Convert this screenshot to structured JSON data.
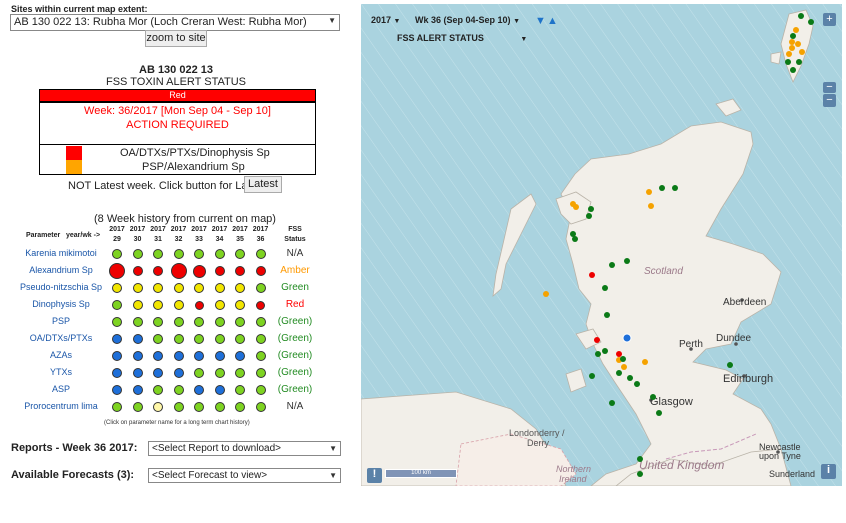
{
  "sites": {
    "label": "Sites within current map extent:",
    "selected": "AB 130 022 13: Rubha Mor (Loch Creran West: Rubha Mor)",
    "zoom_label": "zoom to site"
  },
  "alert": {
    "site_code": "AB 130 022 13",
    "title": "FSS TOXIN ALERT STATUS",
    "status_text": "Red",
    "week_text": "Week: 36/2017 [Mon Sep 04 - Sep 10]",
    "action_text": "ACTION REQUIRED",
    "legend": [
      {
        "color": "#ff0000",
        "text": "OA/DTXs/PTXs/Dinophysis Sp"
      },
      {
        "color": "#ffa500",
        "text": "PSP/Alexandrium Sp"
      }
    ],
    "not_latest_text": "NOT Latest week. Click button for Latest",
    "latest_label": "Latest"
  },
  "history": {
    "title": "(8 Week history from current on map)",
    "param_header": "Parameter",
    "yearwk_header": "year/wk ->",
    "fss_header_1": "FSS",
    "fss_header_2": "Status",
    "years": [
      "2017",
      "2017",
      "2017",
      "2017",
      "2017",
      "2017",
      "2017",
      "2017"
    ],
    "weeks": [
      "29",
      "30",
      "31",
      "32",
      "33",
      "34",
      "35",
      "36"
    ],
    "rows": [
      {
        "name": "Karenia mikimotoi",
        "dots": [
          "green",
          "green",
          "green",
          "green",
          "green",
          "green",
          "green",
          "green"
        ],
        "sizes": [
          1,
          1,
          1,
          1,
          1,
          1,
          1,
          1
        ],
        "status": "N/A",
        "status_color": "#333333"
      },
      {
        "name": "Alexandrium Sp",
        "dots": [
          "red",
          "red",
          "red",
          "red",
          "red",
          "red",
          "red",
          "red"
        ],
        "sizes": [
          1.6,
          1,
          1,
          1.6,
          1.3,
          1,
          1,
          1
        ],
        "status": "Amber",
        "status_color": "#ff9900"
      },
      {
        "name": "Pseudo-nitzschia Sp",
        "dots": [
          "yellow",
          "yellow",
          "yellow",
          "yellow",
          "yellow",
          "yellow",
          "yellow",
          "green"
        ],
        "sizes": [
          1,
          1,
          1,
          1,
          1,
          1,
          1,
          1
        ],
        "status": "Green",
        "status_color": "#228b22"
      },
      {
        "name": "Dinophysis Sp",
        "dots": [
          "green",
          "yellow",
          "yellow",
          "yellow",
          "red",
          "yellow",
          "yellow",
          "red"
        ],
        "sizes": [
          1,
          1,
          1,
          1,
          0.9,
          1,
          1,
          0.9
        ],
        "status": "Red",
        "status_color": "#ff0000"
      },
      {
        "name": "PSP",
        "dots": [
          "green",
          "green",
          "green",
          "green",
          "green",
          "green",
          "green",
          "green"
        ],
        "sizes": [
          1,
          1,
          1,
          1,
          1,
          1,
          1,
          1
        ],
        "status": "(Green)",
        "status_color": "#228b22"
      },
      {
        "name": "OA/DTXs/PTXs",
        "dots": [
          "blue",
          "blue",
          "green",
          "green",
          "green",
          "green",
          "green",
          "green"
        ],
        "sizes": [
          1,
          1,
          1,
          1,
          1,
          1,
          1,
          1
        ],
        "status": "(Green)",
        "status_color": "#228b22"
      },
      {
        "name": "AZAs",
        "dots": [
          "blue",
          "blue",
          "blue",
          "blue",
          "blue",
          "blue",
          "blue",
          "green"
        ],
        "sizes": [
          1,
          1,
          1,
          1,
          1,
          1,
          1,
          1
        ],
        "status": "(Green)",
        "status_color": "#228b22"
      },
      {
        "name": "YTXs",
        "dots": [
          "blue",
          "blue",
          "blue",
          "blue",
          "green",
          "green",
          "green",
          "green"
        ],
        "sizes": [
          1,
          1,
          1,
          1,
          1,
          1,
          1,
          1
        ],
        "status": "(Green)",
        "status_color": "#228b22"
      },
      {
        "name": "ASP",
        "dots": [
          "blue",
          "blue",
          "green",
          "green",
          "blue",
          "blue",
          "green",
          "green"
        ],
        "sizes": [
          1,
          1,
          1,
          1,
          1,
          1,
          1,
          1
        ],
        "status": "(Green)",
        "status_color": "#228b22"
      },
      {
        "name": "Prorocentrum lima",
        "dots": [
          "green",
          "green",
          "lightyellow",
          "green",
          "green",
          "green",
          "green",
          "green"
        ],
        "sizes": [
          1,
          1,
          1,
          1,
          1,
          1,
          1,
          1
        ],
        "status": "N/A",
        "status_color": "#333333"
      }
    ],
    "note": "(Click on parameter name for a long term chart history)"
  },
  "colors": {
    "green": "#7ed321",
    "red": "#ee0000",
    "yellow": "#f2e600",
    "lightyellow": "#fff7a8",
    "blue": "#1e6fd9",
    "orange": "#f5a200",
    "darkgreen": "#0b7a17"
  },
  "reports": {
    "label": "Reports - Week 36 2017:",
    "selected": "<Select Report to download>"
  },
  "forecasts": {
    "label": "Available Forecasts (3):",
    "selected": "<Select Forecast to view>"
  },
  "map": {
    "year": "2017",
    "week": "Wk 36 (Sep 04-Sep 10)",
    "layer": "FSS ALERT STATUS",
    "zoom_in": "+",
    "zoom_out": "−",
    "info": "i",
    "warn": "!",
    "scale_text": "100 km",
    "labels": {
      "scotland": "Scotland",
      "aberdeen": "Aberdeen",
      "dundee": "Dundee",
      "perth": "Perth",
      "edinburgh": "Edinburgh",
      "glasgow": "Glasgow",
      "londonderry": "Londonderry /",
      "derry": "Derry",
      "northern": "Northern",
      "ireland": "Ireland",
      "united_kingdom": "United Kingdom",
      "newcastle": "Newcastle",
      "upon_tyne": "upon Tyne",
      "sunderland": "Sunderland"
    }
  }
}
